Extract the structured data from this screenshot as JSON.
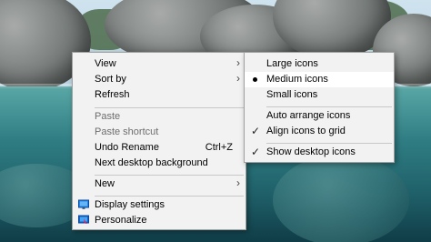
{
  "context_menu": {
    "items": [
      {
        "label": "View",
        "submenu": true
      },
      {
        "label": "Sort by",
        "submenu": true
      },
      {
        "label": "Refresh"
      },
      {
        "label": "Paste",
        "disabled": true
      },
      {
        "label": "Paste shortcut",
        "disabled": true
      },
      {
        "label": "Undo Rename",
        "shortcut": "Ctrl+Z"
      },
      {
        "label": "Next desktop background"
      },
      {
        "label": "New",
        "submenu": true
      },
      {
        "label": "Display settings",
        "icon": "display-settings-icon"
      },
      {
        "label": "Personalize",
        "icon": "personalize-icon"
      }
    ]
  },
  "view_submenu": {
    "items": [
      {
        "label": "Large icons"
      },
      {
        "label": "Medium icons",
        "selected": true
      },
      {
        "label": "Small icons"
      },
      {
        "label": "Auto arrange icons"
      },
      {
        "label": "Align icons to grid",
        "checked": true
      },
      {
        "label": "Show desktop icons",
        "checked": true
      }
    ]
  },
  "colors": {
    "menu_background": "#f2f2f2",
    "highlight": "#ffffff",
    "disabled_text": "#6d6d6d"
  }
}
